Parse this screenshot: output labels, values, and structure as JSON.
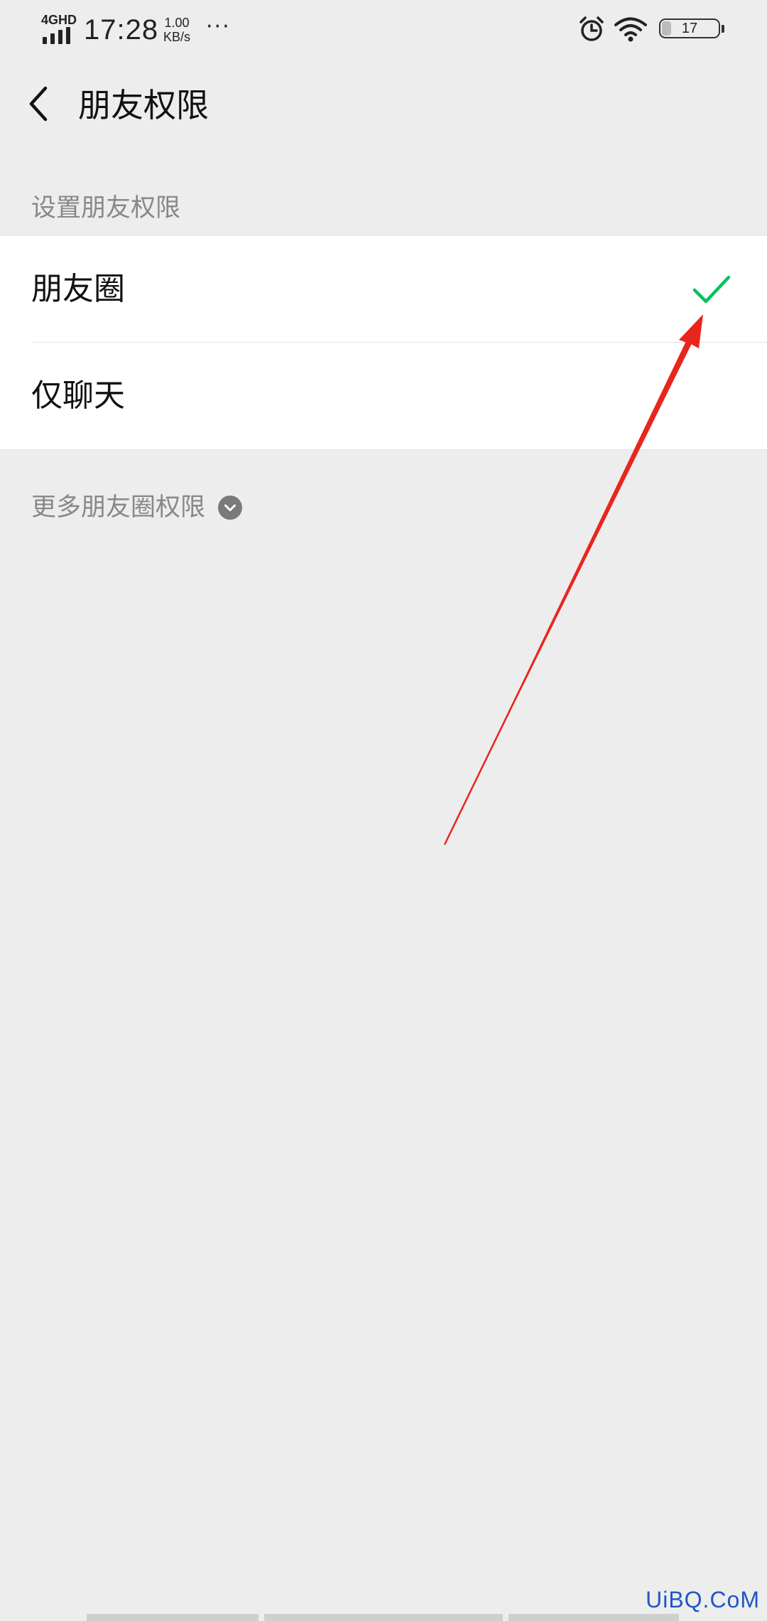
{
  "status_bar": {
    "network_type": "4GHD",
    "time": "17:28",
    "speed_value": "1.00",
    "speed_unit": "KB/s",
    "more": "···",
    "battery_level": "17"
  },
  "header": {
    "title": "朋友权限"
  },
  "section": {
    "title": "设置朋友权限"
  },
  "options": [
    {
      "label": "朋友圈",
      "selected": true
    },
    {
      "label": "仅聊天",
      "selected": false
    }
  ],
  "more_permissions": {
    "label": "更多朋友圈权限"
  },
  "watermark": "UiBQ.CoM",
  "colors": {
    "accent_check": "#07c160",
    "annotation_arrow": "#e8261e",
    "background": "#ededed",
    "watermark": "#1e56c8"
  },
  "icons": {
    "back": "back-chevron-icon",
    "check": "check-icon",
    "expand": "chevron-down-circle-icon",
    "alarm": "alarm-icon",
    "wifi": "wifi-icon",
    "signal": "signal-icon",
    "battery": "battery-icon"
  }
}
